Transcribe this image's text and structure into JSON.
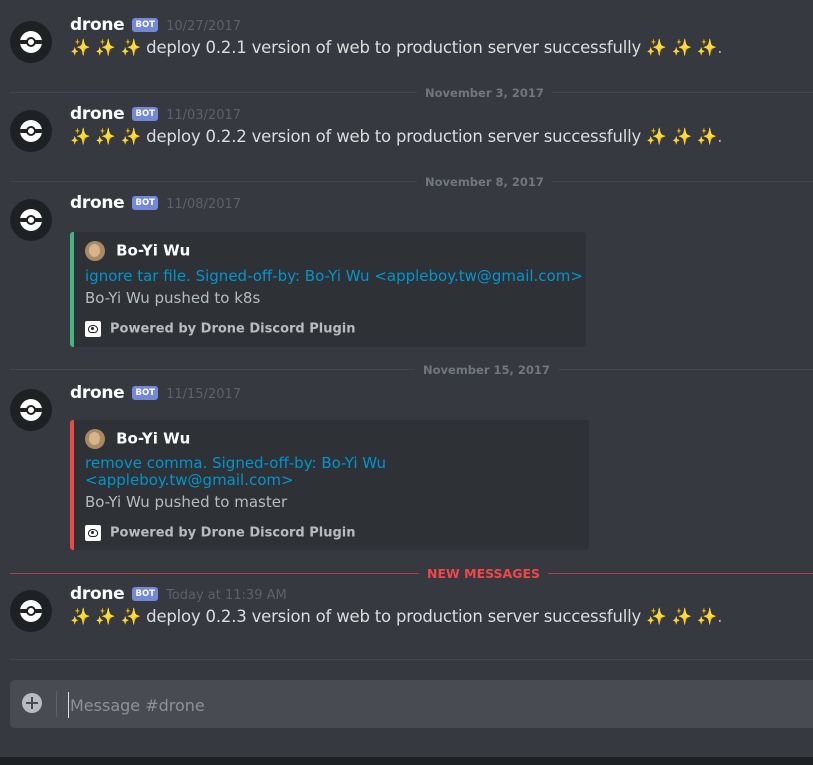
{
  "channel": "drone",
  "messages": [
    {
      "author": "drone",
      "tag": "BOT",
      "timestamp": "10/27/2017",
      "sparkles_left": "✨ ✨ ✨",
      "text": "deploy 0.2.1 version of web to production server successfully",
      "sparkles_right": "✨ ✨ ✨."
    },
    {
      "author": "drone",
      "tag": "BOT",
      "timestamp": "11/03/2017",
      "sparkles_left": "✨ ✨ ✨",
      "text": "deploy 0.2.2 version of web to production server successfully",
      "sparkles_right": "✨ ✨ ✨."
    },
    {
      "author": "drone",
      "tag": "BOT",
      "timestamp": "11/08/2017",
      "embed": {
        "color": "#43b581",
        "author": "Bo-Yi Wu",
        "title": "ignore tar file. Signed-off-by: Bo-Yi Wu <appleboy.tw@gmail.com>",
        "description": "Bo-Yi Wu pushed to k8s",
        "footer": "Powered by Drone Discord Plugin"
      }
    },
    {
      "author": "drone",
      "tag": "BOT",
      "timestamp": "11/15/2017",
      "embed": {
        "color": "#f04747",
        "author": "Bo-Yi Wu",
        "title_line1": "remove comma. Signed-off-by: Bo-Yi Wu",
        "title_line2": "<appleboy.tw@gmail.com>",
        "description": "Bo-Yi Wu pushed to master",
        "footer": "Powered by Drone Discord Plugin"
      }
    },
    {
      "author": "drone",
      "tag": "BOT",
      "timestamp": "Today at 11:39 AM",
      "sparkles_left": "✨ ✨ ✨",
      "text": "deploy 0.2.3 version of web to production server successfully",
      "sparkles_right": "✨ ✨ ✨."
    }
  ],
  "dividers": {
    "d1": "November 3, 2017",
    "d2": "November 8, 2017",
    "d3": "November 15, 2017",
    "new_messages": "NEW MESSAGES"
  },
  "composer": {
    "placeholder": "Message #drone"
  },
  "colors": {
    "background": "#36393f",
    "bot_tag": "#7289da",
    "link": "#0096cf",
    "new_messages": "#f04747"
  },
  "icons": {
    "avatar": "drone-logo-icon",
    "embed_author": "user-avatar",
    "footer": "drone-plugin-icon",
    "composer": "plus-circle-icon"
  }
}
